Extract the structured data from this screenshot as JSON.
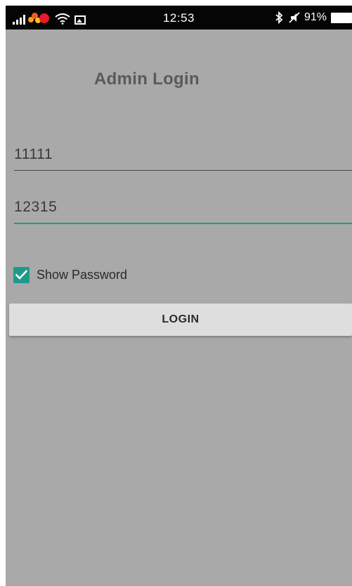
{
  "status_bar": {
    "time": "12:53",
    "battery_percent": "91%",
    "icons": [
      "signal-icon",
      "notification-icon",
      "wifi-icon",
      "image-icon",
      "bluetooth-icon",
      "mute-icon",
      "battery-icon"
    ]
  },
  "login": {
    "title": "Admin Login",
    "username_value": "11111",
    "password_value": "12315",
    "show_password_label": "Show Password",
    "show_password_checked": true,
    "login_button_label": "LOGIN"
  },
  "colors": {
    "accent": "#1e9a8c",
    "background": "#a9a9a9",
    "status_bar": "#050505",
    "button": "#dedede"
  }
}
